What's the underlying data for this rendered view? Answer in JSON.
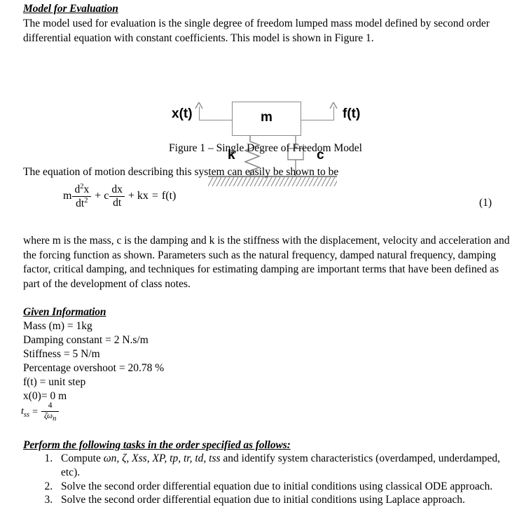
{
  "document": {
    "section1": {
      "heading": "Model for Evaluation",
      "paragraph": "The model used for evaluation is the single degree of freedom lumped mass model defined by second order differential equation with constant coefficients.  This model is shown in Figure 1."
    },
    "figure": {
      "mass_label": "m",
      "spring_label": "k",
      "damper_label": "c",
      "displacement_label": "x(t)",
      "force_label": "f(t)",
      "caption": "Figure 1 – Single Degree of Freedom Model",
      "line_color": "#8a8a8a"
    },
    "equation_intro": "The equation of motion describing this system can easily be shown to be",
    "equation1": {
      "mass_coeff": "m",
      "num_top": "d",
      "num_top_exp": "2",
      "num_var": "x",
      "den": "dt",
      "den_exp": "2",
      "plus1": "+",
      "damp_coeff": "c",
      "dnum": "dx",
      "dden": "dt",
      "plus2": "+",
      "stiff_term": "kx",
      "equals": "=",
      "rhs": "f(t)",
      "number": "(1)"
    },
    "section2": {
      "paragraph": "where m is the mass, c is the damping and k is the stiffness with the displacement, velocity and acceleration and the forcing function as shown.  Parameters such as the natural frequency, damped natural frequency, damping factor, critical damping, and techniques for estimating damping are important terms that have been defined as part of the development of class notes."
    },
    "given": {
      "heading": "Given Information",
      "lines": [
        "Mass (m) = 1kg",
        "Damping constant = 2 N.s/m",
        "Stiffness = 5 N/m",
        "Percentage overshoot = 20.78 %",
        "f(t) = unit step",
        "x(0)= 0 m"
      ],
      "tss_formula": {
        "lhs": "t",
        "lhs_sub": "ss",
        "equals": "=",
        "numerator": "4",
        "denominator": "ζω",
        "denominator_sub": "n"
      }
    },
    "tasks": {
      "heading": "Perform the following tasks in the order specified as follows:",
      "items": [
        {
          "prefix": "Compute ",
          "symbols": "ωn, ζ, Xss, XP, tp, tr, td, tss",
          "suffix": " and identify system characteristics (overdamped, underdamped, etc)."
        },
        {
          "text": "Solve the second order differential equation due to initial conditions using classical ODE approach."
        },
        {
          "text": "Solve the second order differential equation due to initial conditions using Laplace approach."
        }
      ]
    }
  }
}
